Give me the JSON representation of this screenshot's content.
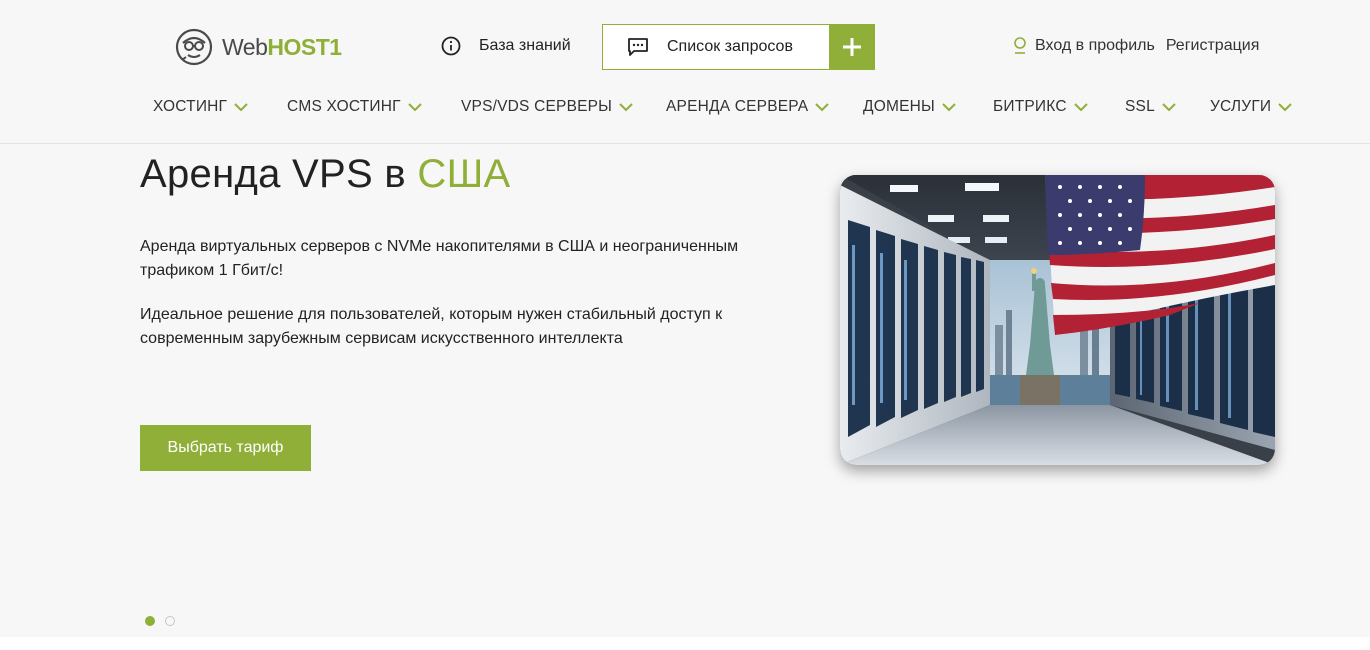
{
  "brand": {
    "name_part1": "Web",
    "name_part2": "HOST1",
    "accent_color": "#8faf38",
    "logo_icon": "mascot-face-icon"
  },
  "header": {
    "knowledge_base": {
      "label": "База знаний",
      "icon": "info-circle-icon"
    },
    "requests": {
      "label": "Список запросов",
      "icon": "chat-bubble-icon",
      "add_icon": "plus-icon"
    },
    "auth": {
      "login_label": "Вход в профиль",
      "login_icon": "user-icon",
      "register_label": "Регистрация"
    }
  },
  "nav": {
    "items": [
      {
        "label": "ХОСТИНГ"
      },
      {
        "label": "CMS ХОСТИНГ"
      },
      {
        "label": "VPS/VDS СЕРВЕРЫ"
      },
      {
        "label": "АРЕНДА СЕРВЕРА"
      },
      {
        "label": "ДОМЕНЫ"
      },
      {
        "label": "БИТРИКС"
      },
      {
        "label": "SSL"
      },
      {
        "label": "УСЛУГИ"
      }
    ],
    "chevron_icon": "chevron-down-icon"
  },
  "hero": {
    "title_part1": "Аренда VPS в ",
    "title_accent": "США",
    "paragraph1": "Аренда виртуальных серверов с NVMe накопителями в США и неограниченным трафиком 1 Гбит/с!",
    "paragraph2": "Идеальное решение для пользователей, которым нужен стабильный доступ к современным зарубежным сервисам искусственного интеллекта",
    "cta_label": "Выбрать тариф",
    "image_subject": "server-room-with-statue-of-liberty-and-us-flag"
  },
  "carousel": {
    "slide_count": 2,
    "active_slide": 1
  }
}
